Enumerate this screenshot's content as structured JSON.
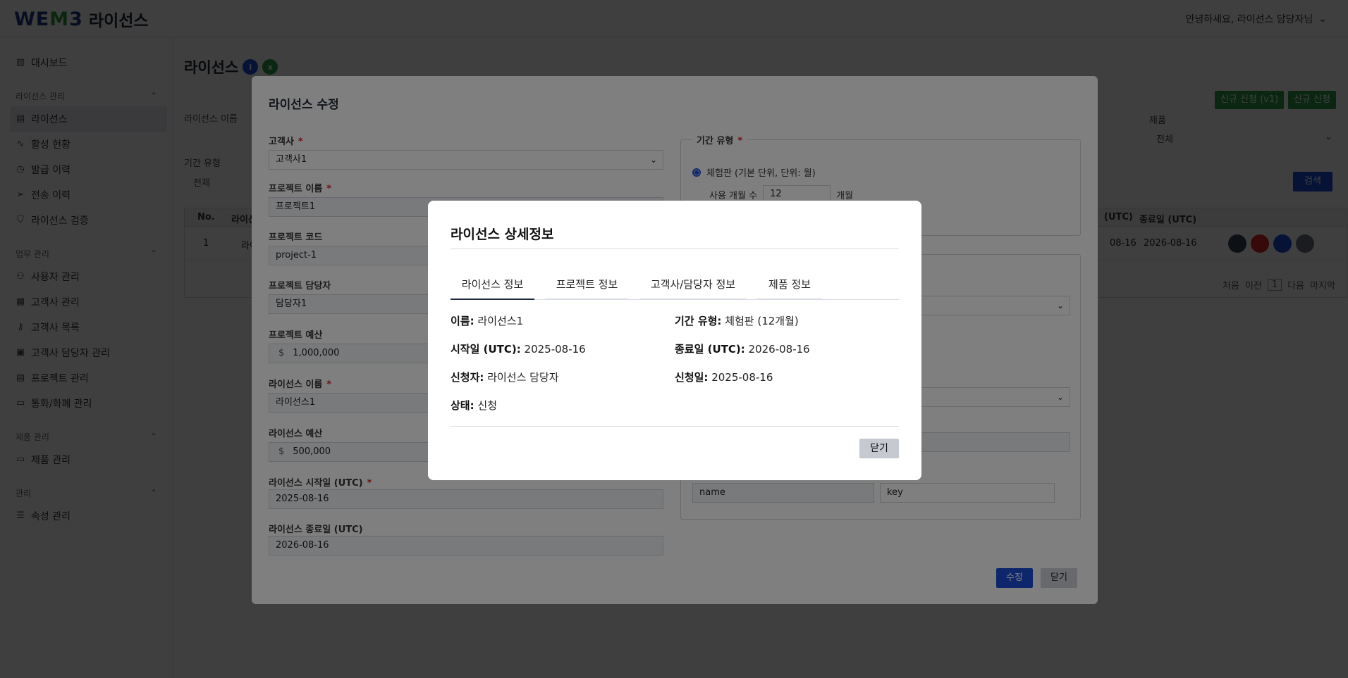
{
  "header": {
    "logo_mark_a": "WE",
    "logo_mark_b": "M",
    "logo_mark_c": "3",
    "logo_text": "라이선스",
    "greeting": "안녕하세요, 라이선스 담당자님"
  },
  "sidebar": {
    "dashboard": "대시보드",
    "group1": "라이선스 관리",
    "g1_items": [
      "라이선스",
      "활성 현황",
      "발급 이력",
      "전송 이력",
      "라이선스 검증"
    ],
    "group2": "업무 관리",
    "g2_items": [
      "사용자 관리",
      "고객사 관리",
      "고객사 목록",
      "고객사 담당자 관리",
      "프로젝트 관리",
      "통화/화폐 관리"
    ],
    "group3": "제품 관리",
    "g3_items": [
      "제품 관리"
    ],
    "group4": "관리",
    "g4_items": [
      "속성 관리"
    ]
  },
  "main": {
    "title": "라이선스",
    "btn_new_v1": "신규 신청 (v1)",
    "btn_new": "신규 신청",
    "filter_license_name": "라이선스 이름",
    "filter_period": "기간 유형",
    "filter_period_value": "전체",
    "filter_product": "제품",
    "filter_product_value": "전체",
    "search": "검색",
    "table_head": [
      "No.",
      "라이선스",
      "(UTC)",
      "종료일 (UTC)"
    ],
    "row": {
      "no": "1",
      "name": "라이",
      "start_tail": "08-16",
      "end": "2026-08-16"
    },
    "pager": {
      "first": "처음",
      "prev": "이전",
      "current": "1",
      "next": "다음",
      "last": "마지막"
    }
  },
  "edit_modal": {
    "title": "라이선스 수정",
    "customer_label": "고객사",
    "customer_value": "고객사1",
    "project_name_label": "프로젝트 이름",
    "project_name_value": "프로젝트1",
    "project_code_label": "프로젝트 코드",
    "project_code_value": "project-1",
    "project_owner_label": "프로젝트 담당자",
    "project_owner_value": "담당자1",
    "project_budget_label": "프로젝트 예산",
    "currency": "$",
    "project_budget_value": "1,000,000",
    "license_name_label": "라이선스 이름",
    "license_name_value": "라이선스1",
    "license_budget_label": "라이선스 예산",
    "license_budget_value": "500,000",
    "start_label": "라이선스 시작일 (UTC)",
    "start_value": "2025-08-16",
    "end_label": "라이선스 종료일 (UTC)",
    "end_value": "2026-08-16",
    "period_legend": "기간 유형",
    "trial_label": "체험판 (기본 단위, 단위: 월)",
    "months_label": "사용 개월 수",
    "months_value": "12",
    "months_unit": "개월",
    "attr_name": "name",
    "attr_key": "key",
    "save": "수정",
    "close": "닫기"
  },
  "detail_modal": {
    "title": "라이선스 상세정보",
    "tabs": [
      "라이선스 정보",
      "프로젝트 정보",
      "고객사/담당자 정보",
      "제품 정보"
    ],
    "name_label": "이름:",
    "name_value": "라이선스1",
    "period_label": "기간 유형:",
    "period_value": "체험판 (12개월)",
    "start_label": "시작일 (UTC):",
    "start_value": "2025-08-16",
    "end_label": "종료일 (UTC):",
    "end_value": "2026-08-16",
    "applicant_label": "신청자:",
    "applicant_value": "라이선스 담당자",
    "apply_date_label": "신청일:",
    "apply_date_value": "2025-08-16",
    "status_label": "상태:",
    "status_value": "신청",
    "close": "닫기"
  }
}
